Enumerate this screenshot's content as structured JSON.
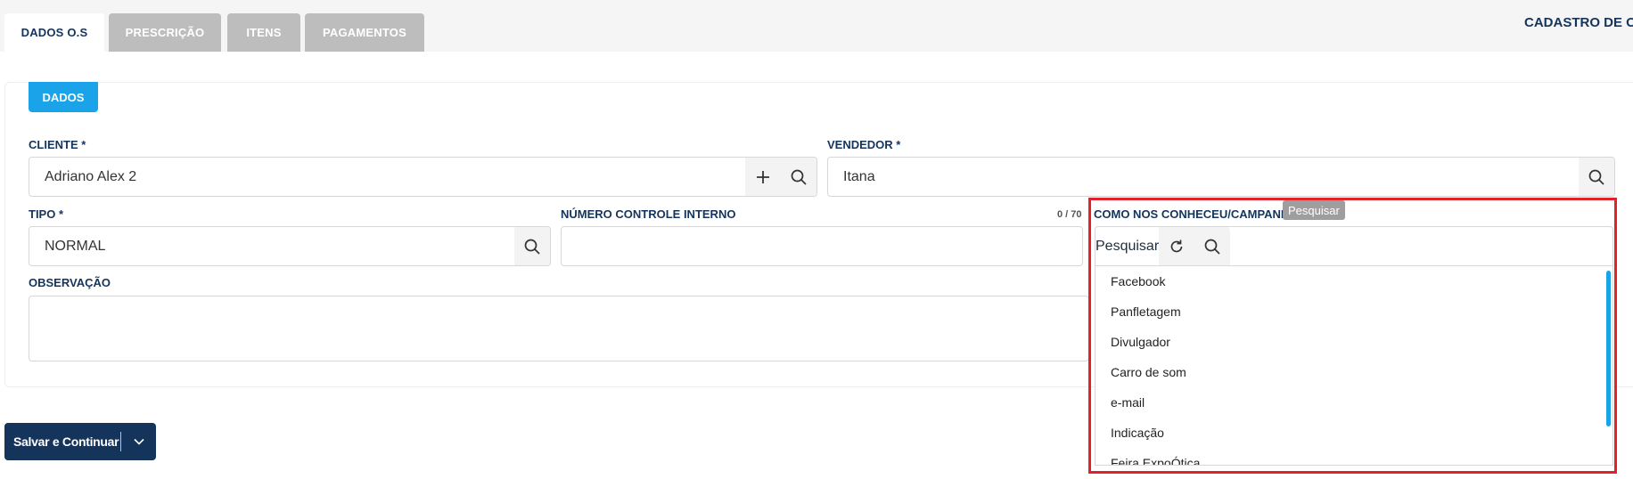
{
  "tabs": [
    {
      "label": "DADOS O.S",
      "active": true
    },
    {
      "label": "PRESCRIÇÃO",
      "active": false
    },
    {
      "label": "ITENS",
      "active": false
    },
    {
      "label": "PAGAMENTOS",
      "active": false
    }
  ],
  "page_title": "CADASTRO DE O.",
  "section_label": "DADOS",
  "form": {
    "cliente": {
      "label": "CLIENTE *",
      "value": "Adriano Alex 2"
    },
    "vendedor": {
      "label": "VENDEDOR *",
      "value": "Itana"
    },
    "tipo": {
      "label": "TIPO *",
      "value": "NORMAL"
    },
    "numero_controle": {
      "label": "NÚMERO CONTROLE INTERNO",
      "counter": "0 / 70",
      "value": ""
    },
    "como_conheceu": {
      "label": "COMO NOS CONHECEU/CAMPANH"
    },
    "observacao": {
      "label": "OBSERVAÇÃO"
    }
  },
  "dropdown": {
    "search_placeholder": "Pesquisar",
    "tooltip": "Pesquisar",
    "options": [
      "Facebook",
      "Panfletagem",
      "Divulgador",
      "Carro de som",
      "e-mail",
      "Indicação",
      "Feira ExpoÓtica"
    ]
  },
  "save_button_label": "Salvar e Continuar",
  "colors": {
    "primary": "#14345c",
    "accent": "#1aa3e8",
    "highlight": "#e2222a",
    "tab_inactive": "#bdbdbd"
  },
  "icons": [
    "search-icon",
    "plus-icon",
    "refresh-icon",
    "chevron-down-icon"
  ]
}
